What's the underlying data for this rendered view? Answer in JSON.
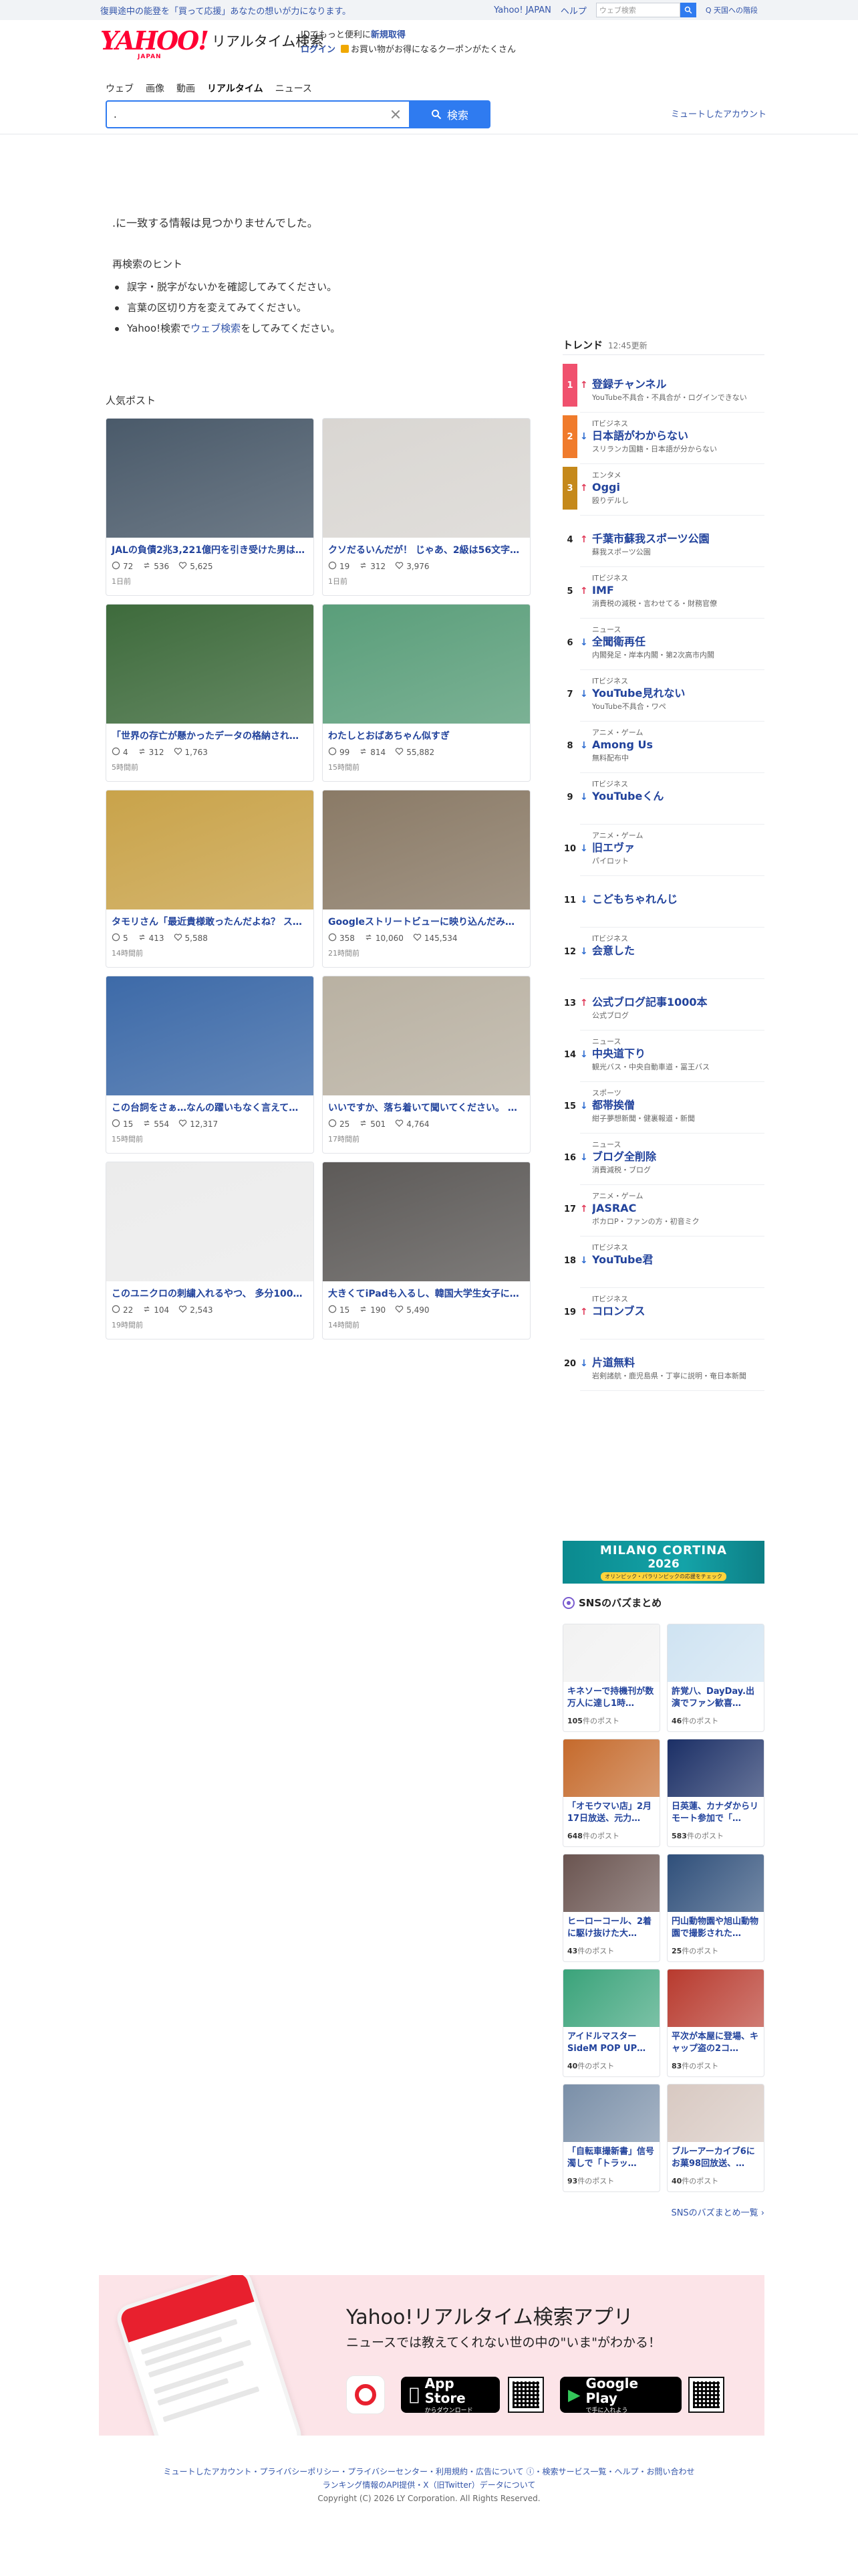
{
  "topbar": {
    "note": "復興途中の能登を「買って応援」あなたの想いが力になります。",
    "links": [
      "Yahoo! JAPAN",
      "ヘルプ"
    ],
    "search_placeholder": "ウェブ検索",
    "search_button": "Q 天国への階段"
  },
  "header": {
    "logo": "YAHOO!",
    "logo_japan": "JAPAN",
    "service": "リアルタイム検索",
    "login_line1_prefix": "IDでもっと便利に",
    "login_line1_link": "新規取得",
    "login_line2_link": "ログイン",
    "login_line2_text": "お買い物がお得になるクーポンがたくさん"
  },
  "tabs": [
    "ウェブ",
    "画像",
    "動画",
    "リアルタイム",
    "ニュース"
  ],
  "search": {
    "value": ".",
    "button": "検索"
  },
  "muted_accounts": "ミュートしたアカウント",
  "no_result": ".に一致する情報は見つかりませんでした。",
  "hints": {
    "title": "再検索のヒント",
    "items": [
      "誤字・脱字がないかを確認してみてください。",
      "言葉の区切り方を変えてみてください。"
    ],
    "last_prefix": "Yahoo!検索で",
    "last_link": "ウェブ検索",
    "last_suffix": "をしてみてください。"
  },
  "popular": {
    "title": "人気ポスト",
    "posts": [
      {
        "title": "JALの負債2兆3,221億円を引き受けた男は…",
        "replies": "72",
        "reposts": "536",
        "likes": "5,625",
        "time": "1日前",
        "color": "#4a5a6a"
      },
      {
        "title": "クソだるいんだが！ じゃあ、2級は56文字…",
        "replies": "19",
        "reposts": "312",
        "likes": "3,976",
        "time": "1日前",
        "color": "#d9d6d2"
      },
      {
        "title": "「世界の存亡が懸かったデータの格納され…",
        "replies": "4",
        "reposts": "312",
        "likes": "1,763",
        "time": "5時間前",
        "color": "#3e6b3c"
      },
      {
        "title": "わたしとおばあちゃん似すぎ",
        "replies": "99",
        "reposts": "814",
        "likes": "55,882",
        "time": "15時間前",
        "color": "#5a9e7a"
      },
      {
        "title": "タモリさん「最近貴様敢ったんだよね？ ス…",
        "replies": "5",
        "reposts": "413",
        "likes": "5,588",
        "time": "14時間前",
        "color": "#c9a34a"
      },
      {
        "title": "Googleストリートビューに映り込んだみ…",
        "replies": "358",
        "reposts": "10,060",
        "likes": "145,534",
        "time": "21時間前",
        "color": "#8a7a66"
      },
      {
        "title": "この台詞をさぁ…なんの躍いもなく言えて…",
        "replies": "15",
        "reposts": "554",
        "likes": "12,317",
        "time": "15時間前",
        "color": "#3d6aa8"
      },
      {
        "title": "いいですか、落ち着いて聞いてください。 …",
        "replies": "25",
        "reposts": "501",
        "likes": "4,764",
        "time": "17時間前",
        "color": "#b9b1a2"
      },
      {
        "title": "このユニクロの刺繍入れるやつ、 多分100…",
        "replies": "22",
        "reposts": "104",
        "likes": "2,543",
        "time": "19時間前",
        "color": "#ececec"
      },
      {
        "title": "大きくてiPadも入るし、韓国大学生女子に…",
        "replies": "15",
        "reposts": "190",
        "likes": "5,490",
        "time": "14時間前",
        "color": "#5d5a58"
      }
    ]
  },
  "trends": {
    "title": "トレンド",
    "time": "12:45更新",
    "items": [
      {
        "rank": "1",
        "dir": "up",
        "cat": "",
        "word": "登録チャンネル",
        "sub": "YouTube不具合・不具合が・ログインできない"
      },
      {
        "rank": "2",
        "dir": "down",
        "cat": "ITビジネス",
        "word": "日本語がわからない",
        "sub": "スリランカ国籍・日本語が分からない"
      },
      {
        "rank": "3",
        "dir": "up",
        "cat": "エンタメ",
        "word": "Oggi",
        "sub": "殴りデルし"
      },
      {
        "rank": "4",
        "dir": "up",
        "cat": "",
        "word": "千葉市蘇我スポーツ公園",
        "sub": "蘇我スポーツ公園"
      },
      {
        "rank": "5",
        "dir": "up",
        "cat": "ITビジネス",
        "word": "IMF",
        "sub": "消費税の減税・言わせてる・財務官僚"
      },
      {
        "rank": "6",
        "dir": "down",
        "cat": "ニュース",
        "word": "全聞衛再任",
        "sub": "内閣発足・岸本内閣・第2次高市内閣"
      },
      {
        "rank": "7",
        "dir": "down",
        "cat": "ITビジネス",
        "word": "YouTube見れない",
        "sub": "YouTube不具合・ワペ"
      },
      {
        "rank": "8",
        "dir": "down",
        "cat": "アニメ・ゲーム",
        "word": "Among Us",
        "sub": "無料配布中"
      },
      {
        "rank": "9",
        "dir": "down",
        "cat": "ITビジネス",
        "word": "YouTubeくん",
        "sub": ""
      },
      {
        "rank": "10",
        "dir": "down",
        "cat": "アニメ・ゲーム",
        "word": "旧エヴァ",
        "sub": "パイロット"
      },
      {
        "rank": "11",
        "dir": "down",
        "cat": "",
        "word": "こどもちゃれんじ",
        "sub": ""
      },
      {
        "rank": "12",
        "dir": "down",
        "cat": "ITビジネス",
        "word": "会意した",
        "sub": ""
      },
      {
        "rank": "13",
        "dir": "up",
        "cat": "",
        "word": "公式ブログ記事1000本",
        "sub": "公式ブログ"
      },
      {
        "rank": "14",
        "dir": "down",
        "cat": "ニュース",
        "word": "中央道下り",
        "sub": "観光バス・中央自動車道・冨王バス"
      },
      {
        "rank": "15",
        "dir": "down",
        "cat": "スポーツ",
        "word": "都帯挨僧",
        "sub": "紺子夢想新聞・健裏報道・新聞"
      },
      {
        "rank": "16",
        "dir": "down",
        "cat": "ニュース",
        "word": "ブログ全削除",
        "sub": "消費減税・ブログ"
      },
      {
        "rank": "17",
        "dir": "up",
        "cat": "アニメ・ゲーム",
        "word": "JASRAC",
        "sub": "ボカロP・ファンの方・初音ミク"
      },
      {
        "rank": "18",
        "dir": "down",
        "cat": "ITビジネス",
        "word": "YouTube君",
        "sub": ""
      },
      {
        "rank": "19",
        "dir": "up",
        "cat": "ITビジネス",
        "word": "コロンブス",
        "sub": ""
      },
      {
        "rank": "20",
        "dir": "down",
        "cat": "",
        "word": "片道無料",
        "sub": "岩剣諸航・鹿児島県・丁寧に説明・奄日本新聞"
      }
    ]
  },
  "ad": {
    "line1": "MILANO CORTINA",
    "line2": "2026",
    "line3": "オリンピック・パラリンピックの応援をチェック"
  },
  "sns": {
    "title": "SNSのバズまとめ",
    "cards": [
      {
        "title": "キネソーで持機刊が数万人に達し1時…",
        "count": "105",
        "color": "#f2f2f2"
      },
      {
        "title": "許覚八、DayDay.出演でファン歓喜…",
        "count": "46",
        "color": "#cfe3f2"
      },
      {
        "title": "「オモウマい店」2月17日放送、元力…",
        "count": "648",
        "color": "#c56a2c"
      },
      {
        "title": "日英蓮、カナダからリモート参加で「…",
        "count": "583",
        "color": "#1b2f66"
      },
      {
        "title": "ヒーローコール、2着に駆け抜けた大…",
        "count": "43",
        "color": "#6a5450"
      },
      {
        "title": "円山動物園や旭山動物園で撮影された…",
        "count": "25",
        "color": "#2f4f7a"
      },
      {
        "title": "アイドルマスター SideM POP UP…",
        "count": "40",
        "color": "#3aa37a"
      },
      {
        "title": "平次が本屋に登場、キャップ盗の2コ…",
        "count": "83",
        "color": "#b83a2e"
      },
      {
        "title": "「自転車撮新書」信号濁しで「トラッ…",
        "count": "93",
        "color": "#7a8fa8"
      },
      {
        "title": "ブルーアーカイブ6にお菓98回放送、…",
        "count": "40",
        "color": "#d8c9c2"
      }
    ],
    "count_suffix": "件のポスト",
    "more": "SNSのバズまとめ一覧 ›"
  },
  "app": {
    "title": "Yahoo!リアルタイム検索アプリ",
    "subtitle": "ニュースでは教えてくれない世の中の\"いま\"がわかる！",
    "appstore_small": "",
    "appstore_big": "App Store",
    "appstore_sub": "からダウンロード",
    "play_small": "",
    "play_big": "Google Play",
    "play_sub": "で手に入れよう"
  },
  "footer": {
    "line1": "ミュートしたアカウント・プライバシーポリシー・プライバシーセンター・利用規約・広告について ⓘ・検索サービス一覧・ヘルプ・お問い合わせ",
    "line2": "ランキング情報のAPI提供・X（旧Twitter）データについて",
    "copyright": "Copyright (C) 2026 LY Corporation. All Rights Reserved."
  }
}
